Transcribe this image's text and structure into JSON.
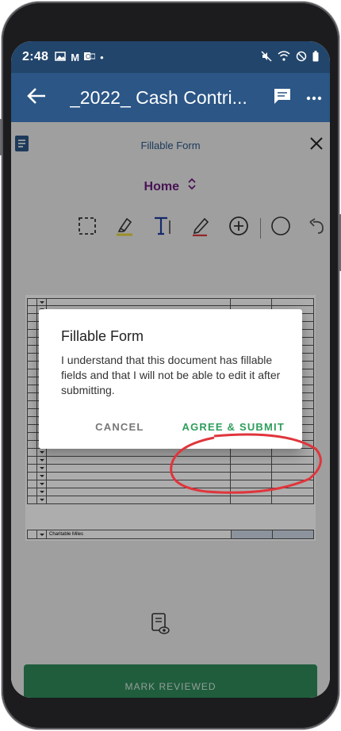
{
  "status_bar": {
    "time": "2:48",
    "notification_icons": [
      "image-icon",
      "gmail-icon",
      "outlook-icon",
      "dot-icon"
    ],
    "system_icons": [
      "mute-icon",
      "wifi-icon",
      "do-not-disturb-icon",
      "battery-icon"
    ]
  },
  "app_bar": {
    "title": "_2022_ Cash Contri..."
  },
  "form_header": {
    "title": "Fillable Form"
  },
  "page_selector": {
    "label": "Home"
  },
  "document": {
    "footer_row_label": "Charitable Miles"
  },
  "dialog": {
    "title": "Fillable Form",
    "body": "I understand that this document has fillable fields and that I will not be able to edit it after submitting.",
    "cancel_label": "CANCEL",
    "agree_label": "AGREE & SUBMIT"
  },
  "footer": {
    "mark_reviewed_label": "MARK REVIEWED"
  },
  "colors": {
    "status_bar": "#22456b",
    "app_bar": "#2b5686",
    "accent_green": "#2e9e5b",
    "home_purple": "#6b1c7e",
    "annotation_red": "#e0353c"
  }
}
